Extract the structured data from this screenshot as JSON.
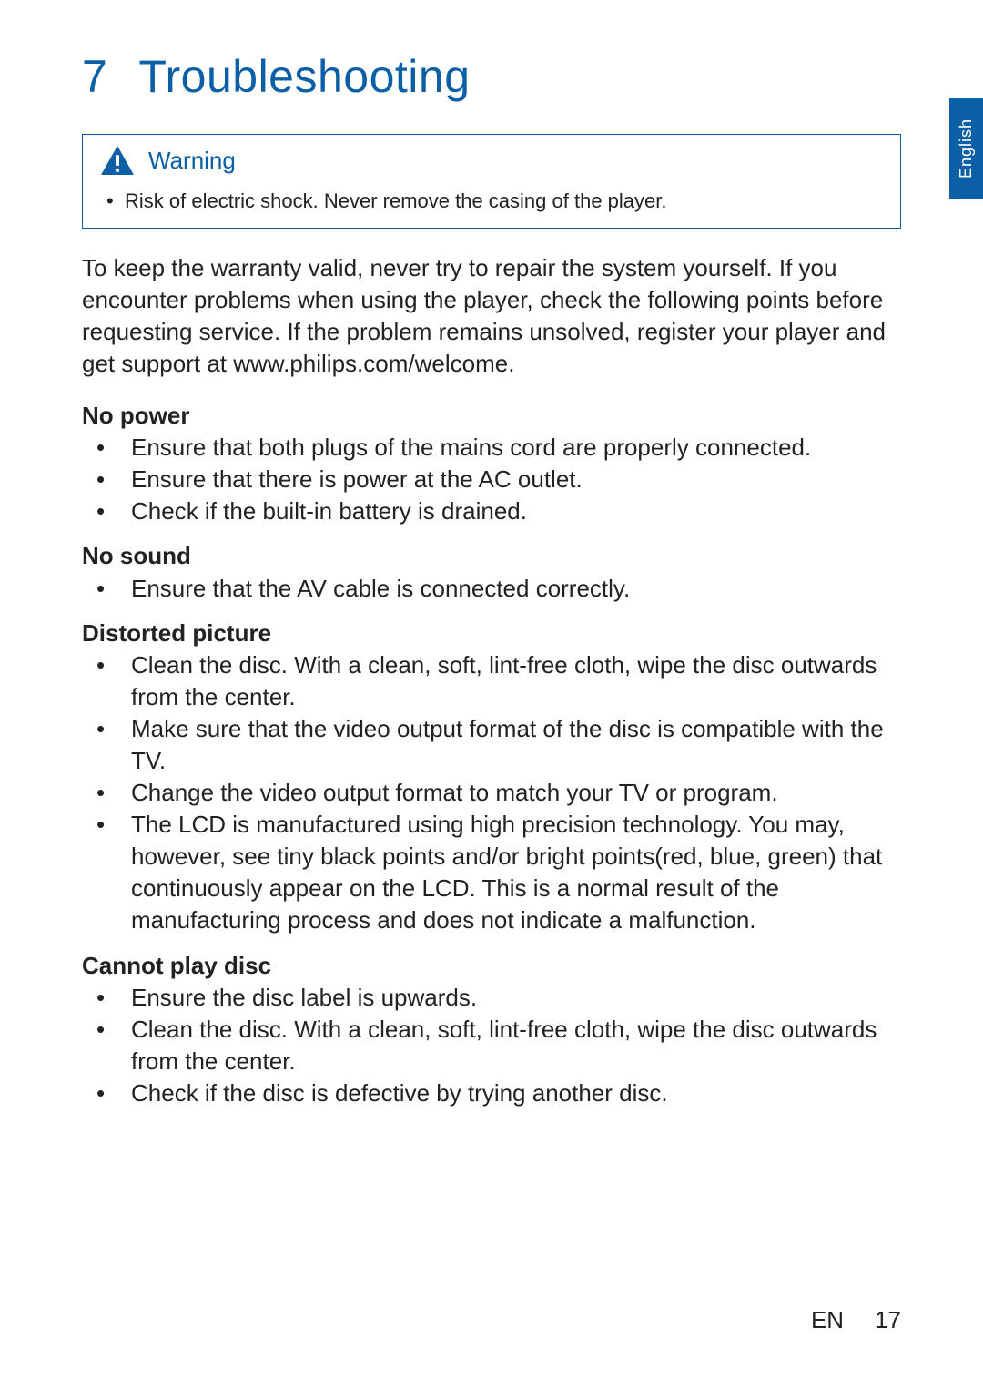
{
  "chapter": {
    "number": "7",
    "title": "Troubleshooting"
  },
  "warning": {
    "label": "Warning",
    "items": [
      "Risk of electric shock. Never remove the casing of the player."
    ]
  },
  "intro": "To keep the warranty valid, never try to repair the system yourself. If you encounter problems when using the player, check the following points before requesting service. If the problem remains unsolved, register your player and get support at www.philips.com/welcome.",
  "sections": [
    {
      "title": "No power",
      "items": [
        "Ensure that both plugs of the mains cord are properly connected.",
        "Ensure that there is power at the AC outlet.",
        "Check if the built-in battery is drained."
      ]
    },
    {
      "title": "No sound",
      "items": [
        "Ensure that the AV cable is connected correctly."
      ]
    },
    {
      "title": "Distorted picture",
      "items": [
        "Clean the disc. With a clean, soft, lint-free cloth, wipe the disc outwards from the center.",
        "Make sure that the video output format of the disc is compatible with the TV.",
        "Change the video output format to match your TV or program.",
        "The LCD is manufactured using high precision technology. You may, however, see tiny black points and/or bright points(red, blue, green) that continuously appear on the LCD. This is a normal result of the manufacturing process and does not indicate a malfunction."
      ]
    },
    {
      "title": "Cannot play disc",
      "items": [
        "Ensure the disc label is upwards.",
        "Clean the disc. With a clean, soft, lint-free cloth, wipe the disc outwards from the center.",
        "Check if the disc is defective by trying another disc."
      ]
    }
  ],
  "langTab": "English",
  "footer": {
    "lang": "EN",
    "page": "17"
  }
}
